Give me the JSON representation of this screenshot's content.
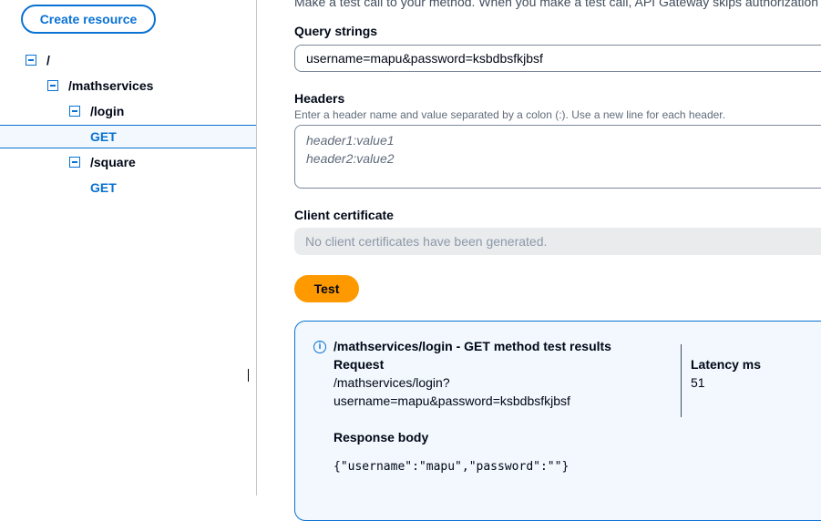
{
  "sidebar": {
    "create_button": "Create resource",
    "tree": [
      {
        "label": "/",
        "type": "resource"
      },
      {
        "label": "/mathservices",
        "type": "resource"
      },
      {
        "label": "/login",
        "type": "resource"
      },
      {
        "label": "GET",
        "type": "method",
        "selected": true
      },
      {
        "label": "/square",
        "type": "resource"
      },
      {
        "label": "GET",
        "type": "method"
      }
    ]
  },
  "main": {
    "top_text": "Make a test call to your method. When you make a test call, API Gateway skips authorization",
    "query_strings": {
      "label": "Query strings",
      "value": "username=mapu&password=ksbdbsfkjbsf"
    },
    "headers": {
      "label": "Headers",
      "description": "Enter a header name and value separated by a colon (:). Use a new line for each header.",
      "placeholder": "header1:value1\nheader2:value2"
    },
    "client_certificate": {
      "label": "Client certificate",
      "placeholder": "No client certificates have been generated."
    },
    "test_button": "Test",
    "results": {
      "title": "/mathservices/login - GET method test results",
      "request_label": "Request",
      "request_line1": "/mathservices/login?",
      "request_line2": "username=mapu&password=ksbdbsfkjbsf",
      "latency_label": "Latency ms",
      "latency_value": "51",
      "response_label": "Response body",
      "response_body": "{\"username\":\"mapu\",\"password\":\"\"}"
    }
  },
  "colors": {
    "accent": "#0972d3",
    "test_button": "#ff9900",
    "selected_bg": "#f2f8fd"
  }
}
